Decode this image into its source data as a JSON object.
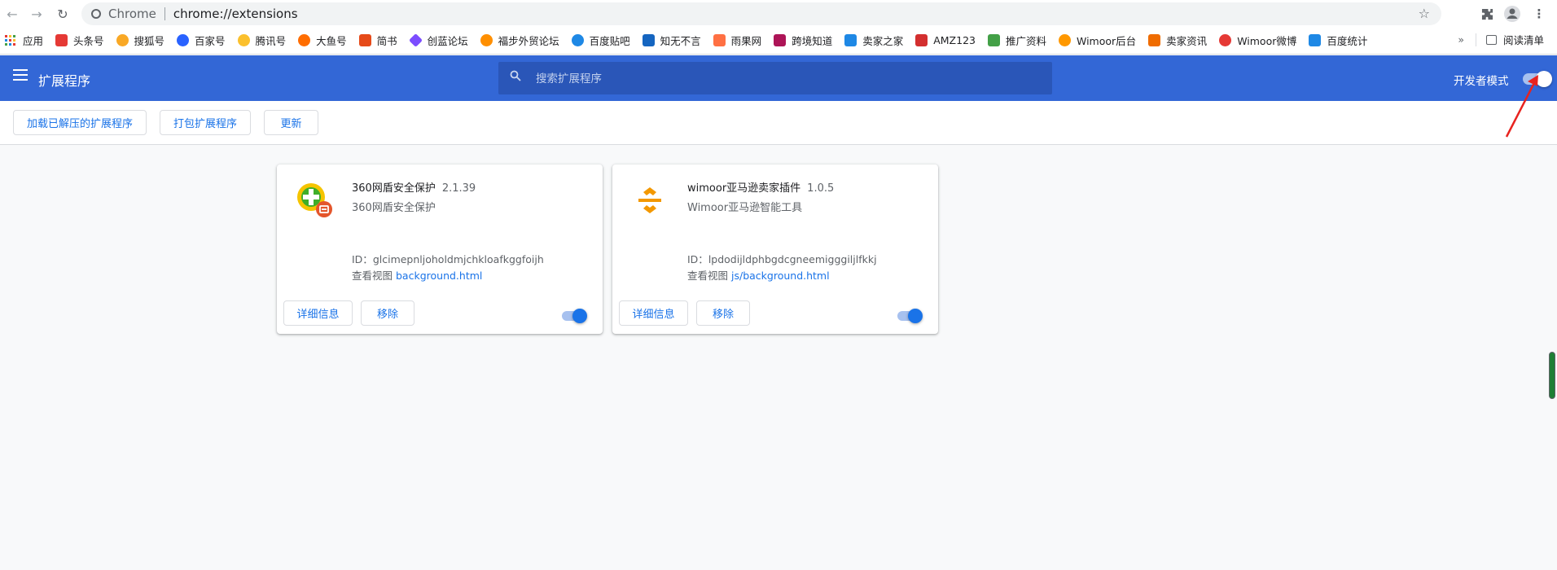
{
  "browser": {
    "origin_label": "Chrome",
    "url": "chrome://extensions"
  },
  "bookmarks": [
    {
      "label": "应用",
      "color": "#e53935"
    },
    {
      "label": "头条号",
      "color": "#e53935"
    },
    {
      "label": "搜狐号",
      "color": "#f9a825"
    },
    {
      "label": "百家号",
      "color": "#2962ff"
    },
    {
      "label": "腾讯号",
      "color": "#fbc02d"
    },
    {
      "label": "大鱼号",
      "color": "#ff6d00"
    },
    {
      "label": "简书",
      "color": "#e64a19"
    },
    {
      "label": "创蓝论坛",
      "color": "#7c4dff"
    },
    {
      "label": "福步外贸论坛",
      "color": "#ff8f00"
    },
    {
      "label": "百度贴吧",
      "color": "#1e88e5"
    },
    {
      "label": "知无不言",
      "color": "#1565c0"
    },
    {
      "label": "雨果网",
      "color": "#ff7043"
    },
    {
      "label": "跨境知道",
      "color": "#ad1457"
    },
    {
      "label": "卖家之家",
      "color": "#1e88e5"
    },
    {
      "label": "AMZ123",
      "color": "#d32f2f"
    },
    {
      "label": "推广资料",
      "color": "#43a047"
    },
    {
      "label": "Wimoor后台",
      "color": "#ff9800"
    },
    {
      "label": "卖家资讯",
      "color": "#ef6c00"
    },
    {
      "label": "Wimoor微博",
      "color": "#e53935"
    },
    {
      "label": "百度统计",
      "color": "#1e88e5"
    }
  ],
  "bookmarks_more": "»",
  "reading_list": "阅读清单",
  "header": {
    "title": "扩展程序",
    "search_placeholder": "搜索扩展程序",
    "dev_mode_label": "开发者模式",
    "dev_mode_on": true
  },
  "toolbar": {
    "load_unpacked": "加载已解压的扩展程序",
    "pack": "打包扩展程序",
    "update": "更新"
  },
  "extensions": [
    {
      "name": "360网盾安全保护",
      "version": "2.1.39",
      "description": "360网盾安全保护",
      "id_label": "ID：",
      "id": "glcimepnljoholdmjchkloafkggfoijh",
      "views_label": "查看视图",
      "view_link": "background.html",
      "details_label": "详细信息",
      "remove_label": "移除",
      "enabled": true
    },
    {
      "name": "wimoor亚马逊卖家插件",
      "version": "1.0.5",
      "description": "Wimoor亚马逊智能工具",
      "id_label": "ID：",
      "id": "lpdodijldphbgdcgneemigggiljlfkkj",
      "views_label": "查看视图",
      "view_link": "js/background.html",
      "details_label": "详细信息",
      "remove_label": "移除",
      "enabled": true
    }
  ],
  "colors": {
    "header_blue": "#3367d6",
    "link_blue": "#1a73e8",
    "arrow_red": "#e8231f"
  }
}
